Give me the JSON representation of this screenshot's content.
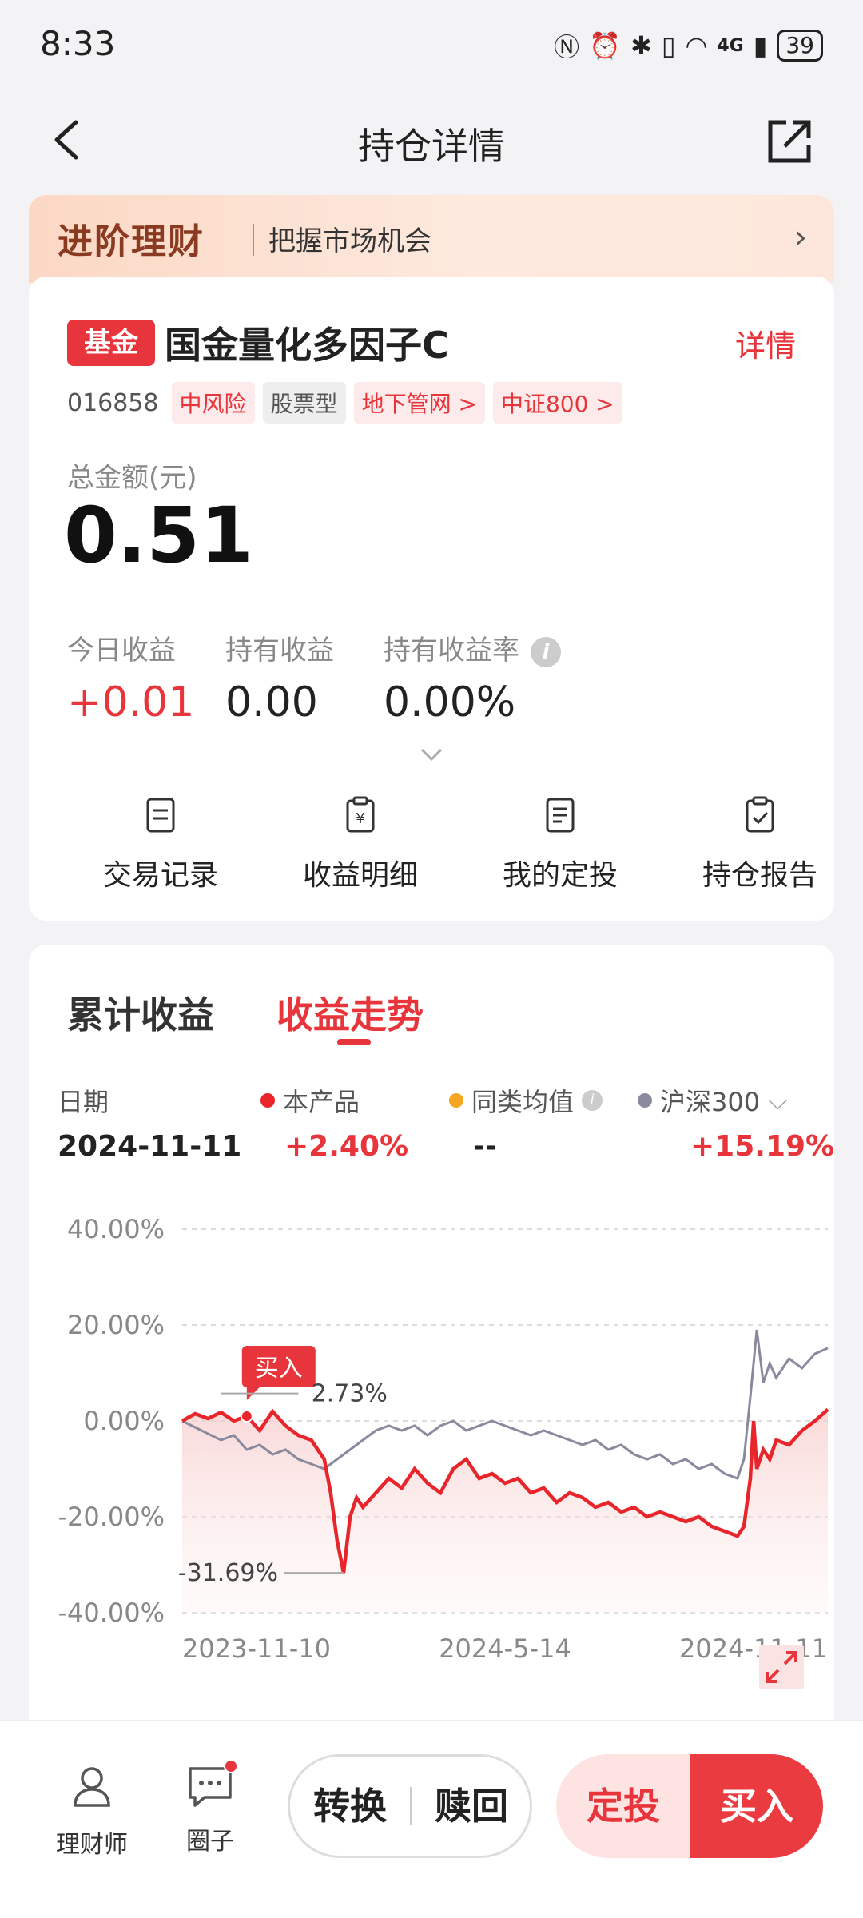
{
  "status_bar": {
    "time": "8:33",
    "network": "4G",
    "battery": "39"
  },
  "header": {
    "title": "持仓详情"
  },
  "promo": {
    "tag": "进阶理财",
    "text": "把握市场机会"
  },
  "fund": {
    "badge": "基金",
    "name": "国金量化多因子C",
    "detail_link": "详情",
    "code": "016858",
    "tags": [
      "中风险",
      "股票型",
      "地下管网 >",
      "中证800 >"
    ],
    "total_label": "总金额(元)",
    "total_value": "0.51",
    "stats": [
      {
        "label": "今日收益",
        "value": "+0.01"
      },
      {
        "label": "持有收益",
        "value": "0.00"
      },
      {
        "label": "持有收益率",
        "value": "0.00%"
      }
    ],
    "actions": [
      "交易记录",
      "收益明细",
      "我的定投",
      "持仓报告"
    ]
  },
  "chart_section": {
    "tabs": [
      "累计收益",
      "收益走势"
    ],
    "active_tab": "收益走势",
    "legend": {
      "date_label": "日期",
      "date_value": "2024-11-11",
      "series": [
        {
          "name": "本产品",
          "value": "+2.40%",
          "color": "#e8252b"
        },
        {
          "name": "同类均值",
          "value": "--",
          "color": "#f5a623"
        },
        {
          "name": "沪深300",
          "value": "+15.19%",
          "color": "#8a8a9e"
        }
      ]
    }
  },
  "chart_data": {
    "type": "line",
    "y_ticks": [
      "40.00%",
      "20.00%",
      "0.00%",
      "-20.00%",
      "-40.00%"
    ],
    "ylim": [
      -40,
      40
    ],
    "x_ticks": [
      "2023-11-10",
      "2024-5-14",
      "2024-11-11"
    ],
    "annotations": {
      "buy_label": "买入",
      "max_label": "2.73%",
      "min_label": "-31.69%"
    },
    "series": [
      {
        "name": "本产品",
        "color": "#e8252b",
        "x": [
          0,
          0.02,
          0.04,
          0.06,
          0.08,
          0.1,
          0.12,
          0.14,
          0.16,
          0.18,
          0.2,
          0.22,
          0.23,
          0.24,
          0.25,
          0.26,
          0.27,
          0.28,
          0.3,
          0.32,
          0.34,
          0.36,
          0.38,
          0.4,
          0.42,
          0.44,
          0.46,
          0.48,
          0.5,
          0.52,
          0.54,
          0.56,
          0.58,
          0.6,
          0.62,
          0.64,
          0.66,
          0.68,
          0.7,
          0.72,
          0.74,
          0.76,
          0.78,
          0.8,
          0.82,
          0.84,
          0.86,
          0.87,
          0.88,
          0.885,
          0.89,
          0.9,
          0.91,
          0.92,
          0.94,
          0.96,
          0.98,
          1.0
        ],
        "y": [
          0,
          1.5,
          0.5,
          1.8,
          0,
          1,
          -2,
          2,
          -1,
          -3,
          -4,
          -8,
          -15,
          -25,
          -31.69,
          -20,
          -16,
          -18,
          -15,
          -12,
          -14,
          -10,
          -13,
          -15,
          -10,
          -8,
          -12,
          -11,
          -13,
          -12,
          -15,
          -14,
          -17,
          -15,
          -16,
          -18,
          -17,
          -19,
          -18,
          -20,
          -19,
          -20,
          -21,
          -20,
          -22,
          -23,
          -24,
          -22,
          -12,
          0,
          -10,
          -6,
          -8,
          -4,
          -5,
          -2,
          0,
          2.4
        ]
      },
      {
        "name": "沪深300",
        "color": "#8a8a9e",
        "x": [
          0,
          0.03,
          0.06,
          0.08,
          0.1,
          0.12,
          0.14,
          0.16,
          0.18,
          0.2,
          0.22,
          0.24,
          0.26,
          0.28,
          0.3,
          0.32,
          0.34,
          0.36,
          0.38,
          0.4,
          0.42,
          0.44,
          0.46,
          0.48,
          0.5,
          0.52,
          0.54,
          0.56,
          0.58,
          0.6,
          0.62,
          0.64,
          0.66,
          0.68,
          0.7,
          0.72,
          0.74,
          0.76,
          0.78,
          0.8,
          0.82,
          0.84,
          0.86,
          0.87,
          0.88,
          0.89,
          0.9,
          0.91,
          0.92,
          0.94,
          0.96,
          0.98,
          1.0
        ],
        "y": [
          0,
          -2,
          -4,
          -3,
          -6,
          -5,
          -7,
          -6,
          -8,
          -9,
          -10,
          -8,
          -6,
          -4,
          -2,
          -1,
          -2,
          -1,
          -3,
          -1,
          0,
          -2,
          -1,
          0,
          -1,
          -2,
          -3,
          -2,
          -3,
          -4,
          -5,
          -4,
          -6,
          -5,
          -7,
          -8,
          -7,
          -9,
          -8,
          -10,
          -9,
          -11,
          -12,
          -8,
          5,
          19,
          8,
          12,
          9,
          13,
          11,
          14,
          15.19
        ]
      }
    ]
  },
  "bottom_bar": {
    "advisor": "理财师",
    "circle": "圈子",
    "convert": "转换",
    "redeem": "赎回",
    "dingtou": "定投",
    "buy": "买入"
  }
}
